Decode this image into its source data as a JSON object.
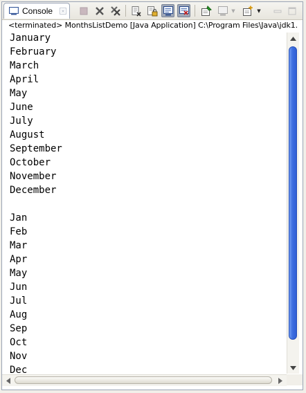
{
  "view": {
    "tab_label": "Console",
    "status": "<terminated> MonthsListDemo [Java Application] C:\\Program Files\\Java\\jdk1."
  },
  "toolbar": {
    "icons": [
      "terminate-icon",
      "remove-launch-icon",
      "remove-all-terminated-icon",
      "clear-console-icon",
      "scroll-lock-icon",
      "show-on-stdout-icon",
      "show-on-stderr-icon",
      "pin-console-icon",
      "display-selected-console-icon",
      "open-console-icon"
    ]
  },
  "console": {
    "lines": [
      "January",
      "February",
      "March",
      "April",
      "May",
      "June",
      "July",
      "August",
      "September",
      "October",
      "November",
      "December",
      "",
      "Jan",
      "Feb",
      "Mar",
      "Apr",
      "May",
      "Jun",
      "Jul",
      "Aug",
      "Sep",
      "Oct",
      "Nov",
      "Dec"
    ]
  },
  "colors": {
    "scroll_thumb": "#3c6ee0",
    "frame_border": "#9aa4b5",
    "background": "#f1efe9"
  }
}
